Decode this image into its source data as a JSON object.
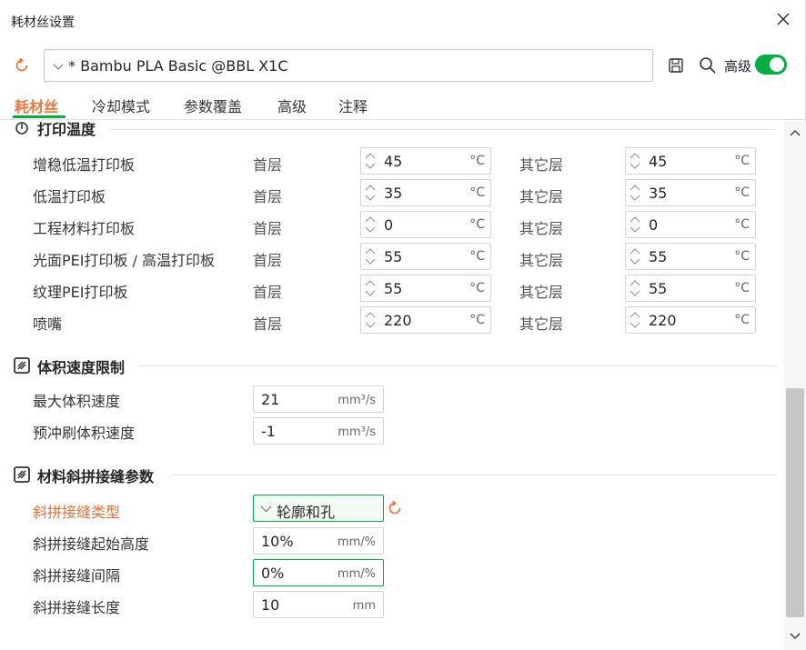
{
  "window": {
    "title": "耗材丝设置"
  },
  "preset": {
    "name": "* Bambu PLA Basic @BBL X1C"
  },
  "toolbar": {
    "advanced_label": "高级"
  },
  "tabs": [
    {
      "label": "耗材丝"
    },
    {
      "label": "冷却模式"
    },
    {
      "label": "参数覆盖"
    },
    {
      "label": "高级"
    },
    {
      "label": "注释"
    }
  ],
  "print_temp": {
    "title": "打印温度",
    "first_layer_label": "首层",
    "other_layers_label": "其它层",
    "unit": "°C",
    "rows": [
      {
        "label": "增稳低温打印板",
        "first": "45",
        "other": "45"
      },
      {
        "label": "低温打印板",
        "first": "35",
        "other": "35"
      },
      {
        "label": "工程材料打印板",
        "first": "0",
        "other": "0"
      },
      {
        "label": "光面PEI打印板 / 高温打印板",
        "first": "55",
        "other": "55"
      },
      {
        "label": "纹理PEI打印板",
        "first": "55",
        "other": "55"
      },
      {
        "label": "喷嘴",
        "first": "220",
        "other": "220"
      }
    ]
  },
  "volumetric": {
    "title": "体积速度限制",
    "rows": [
      {
        "label": "最大体积速度",
        "value": "21",
        "unit": "mm³/s"
      },
      {
        "label": "预冲刷体积速度",
        "value": "-1",
        "unit": "mm³/s"
      }
    ]
  },
  "scarf": {
    "title": "材料斜拼接缝参数",
    "type_label": "斜拼接缝类型",
    "type_value": "轮廓和孔",
    "rows": [
      {
        "label": "斜拼接缝起始高度",
        "value": "10%",
        "unit": "mm/%"
      },
      {
        "label": "斜拼接缝间隔",
        "value": "0%",
        "unit": "mm/%"
      },
      {
        "label": "斜拼接缝长度",
        "value": "10",
        "unit": "mm"
      }
    ]
  },
  "colors": {
    "accent_green": "#00ae42",
    "modified_orange": "#ea6f37"
  }
}
